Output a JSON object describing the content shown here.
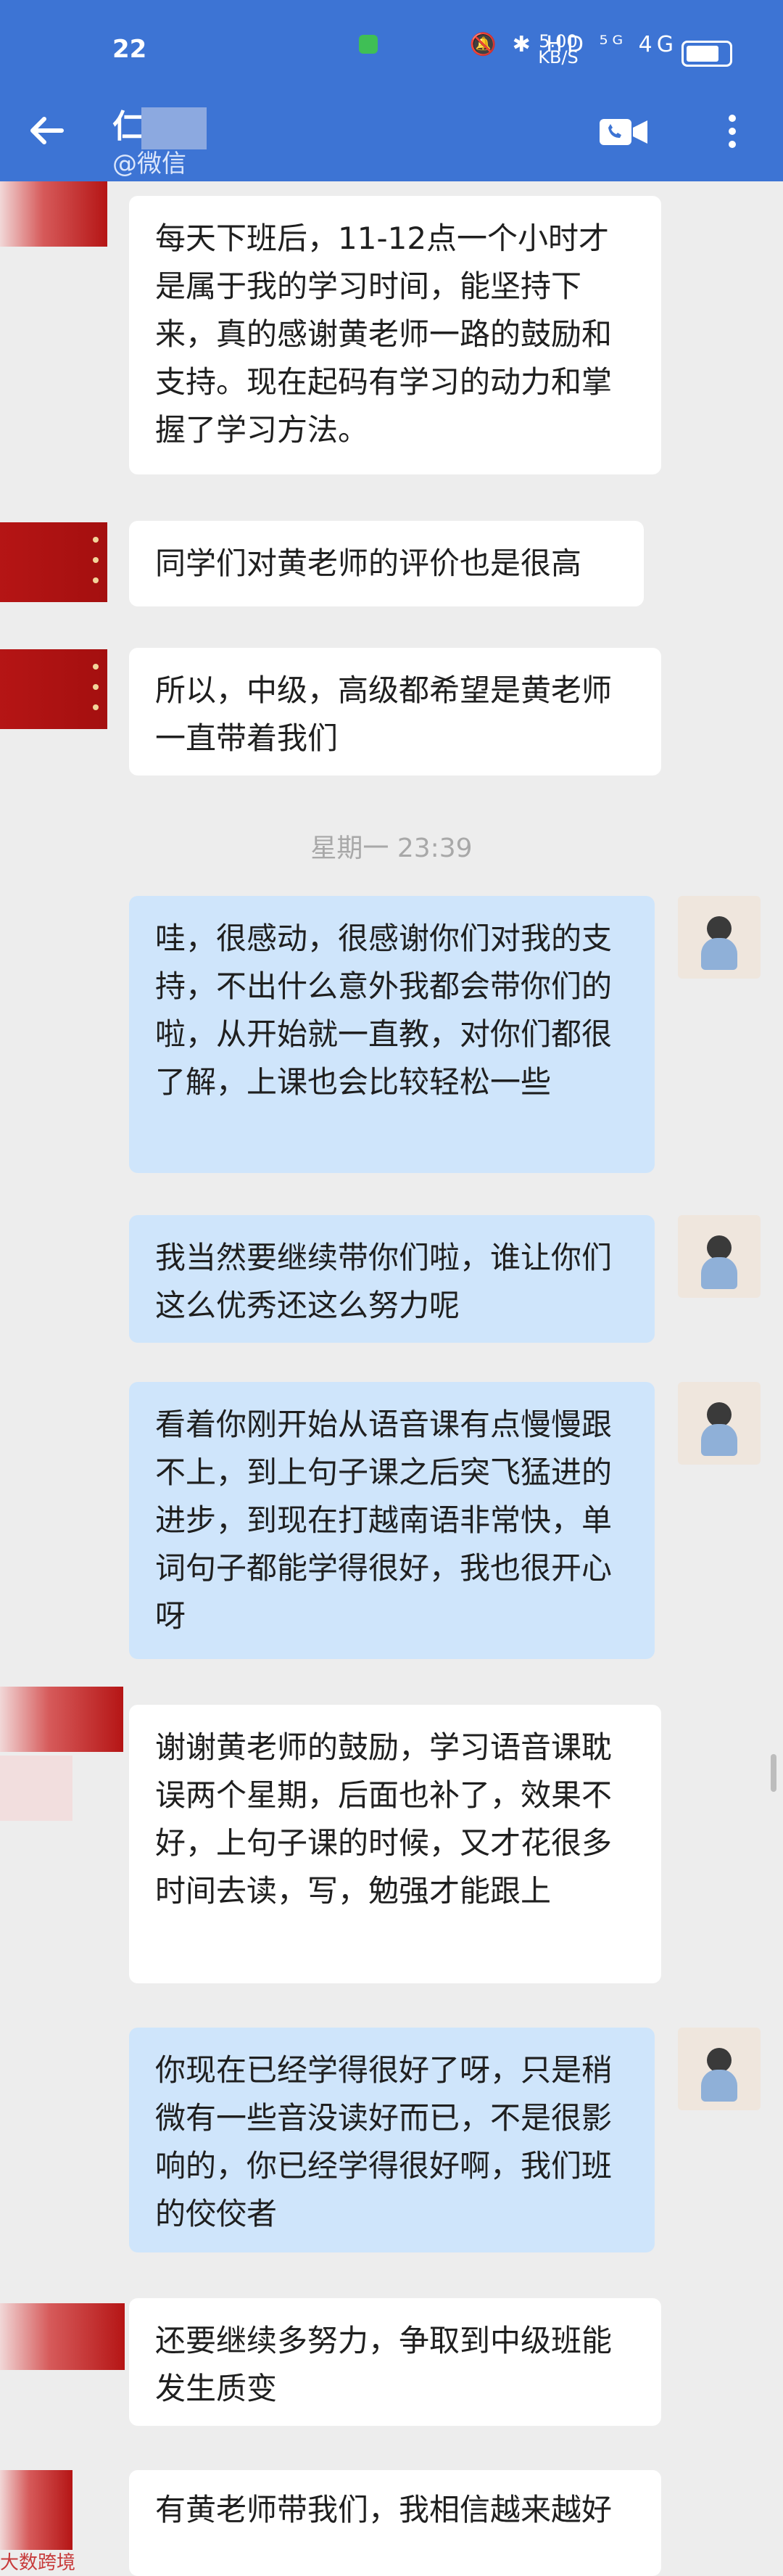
{
  "status_bar": {
    "time": "22",
    "network_speed": "5.00 KB/S",
    "icons": "🔕 ✱ HD ⁵ᴳ 4G"
  },
  "header": {
    "back_icon": "arrow-left-icon",
    "contact_name": "仁",
    "contact_sub": "@微信",
    "video_icon": "video-call-icon",
    "more_icon": "more-vertical-icon"
  },
  "messages": [
    {
      "side": "in",
      "text": "每天下班后，11-12点一个小时才是属于我的学习时间，能坚持下来，真的感谢黄老师一路的鼓励和支持。现在起码有学习的动力和掌握了学习方法。"
    },
    {
      "side": "in",
      "text": "同学们对黄老师的评价也是很高"
    },
    {
      "side": "in",
      "text": "所以，中级，高级都希望是黄老师一直带着我们"
    },
    {
      "side": "out",
      "text": "哇，很感动，很感谢你们对我的支持，不出什么意外我都会带你们的啦，从开始就一直教，对你们都很了解，上课也会比较轻松一些"
    },
    {
      "side": "out",
      "text": "我当然要继续带你们啦，谁让你们这么优秀还这么努力呢"
    },
    {
      "side": "out",
      "text": "看着你刚开始从语音课有点慢慢跟不上，到上句子课之后突飞猛进的进步，到现在打越南语非常快，单词句子都能学得很好，我也很开心呀"
    },
    {
      "side": "in",
      "text": "谢谢黄老师的鼓励，学习语音课耽误两个星期，后面也补了，效果不好，上句子课的时候，又才花很多时间去读，写，勉强才能跟上"
    },
    {
      "side": "out",
      "text": "你现在已经学得很好了呀，只是稍微有一些音没读好而已，不是很影响的，你已经学得很好啊，我们班的佼佼者"
    },
    {
      "side": "in",
      "text": "还要继续多努力，争取到中级班能发生质变"
    },
    {
      "side": "in",
      "text": "有黄老师带我们，我相信越来越好"
    }
  ],
  "time_divider": "星期一 23:39",
  "watermark": "大数跨境"
}
